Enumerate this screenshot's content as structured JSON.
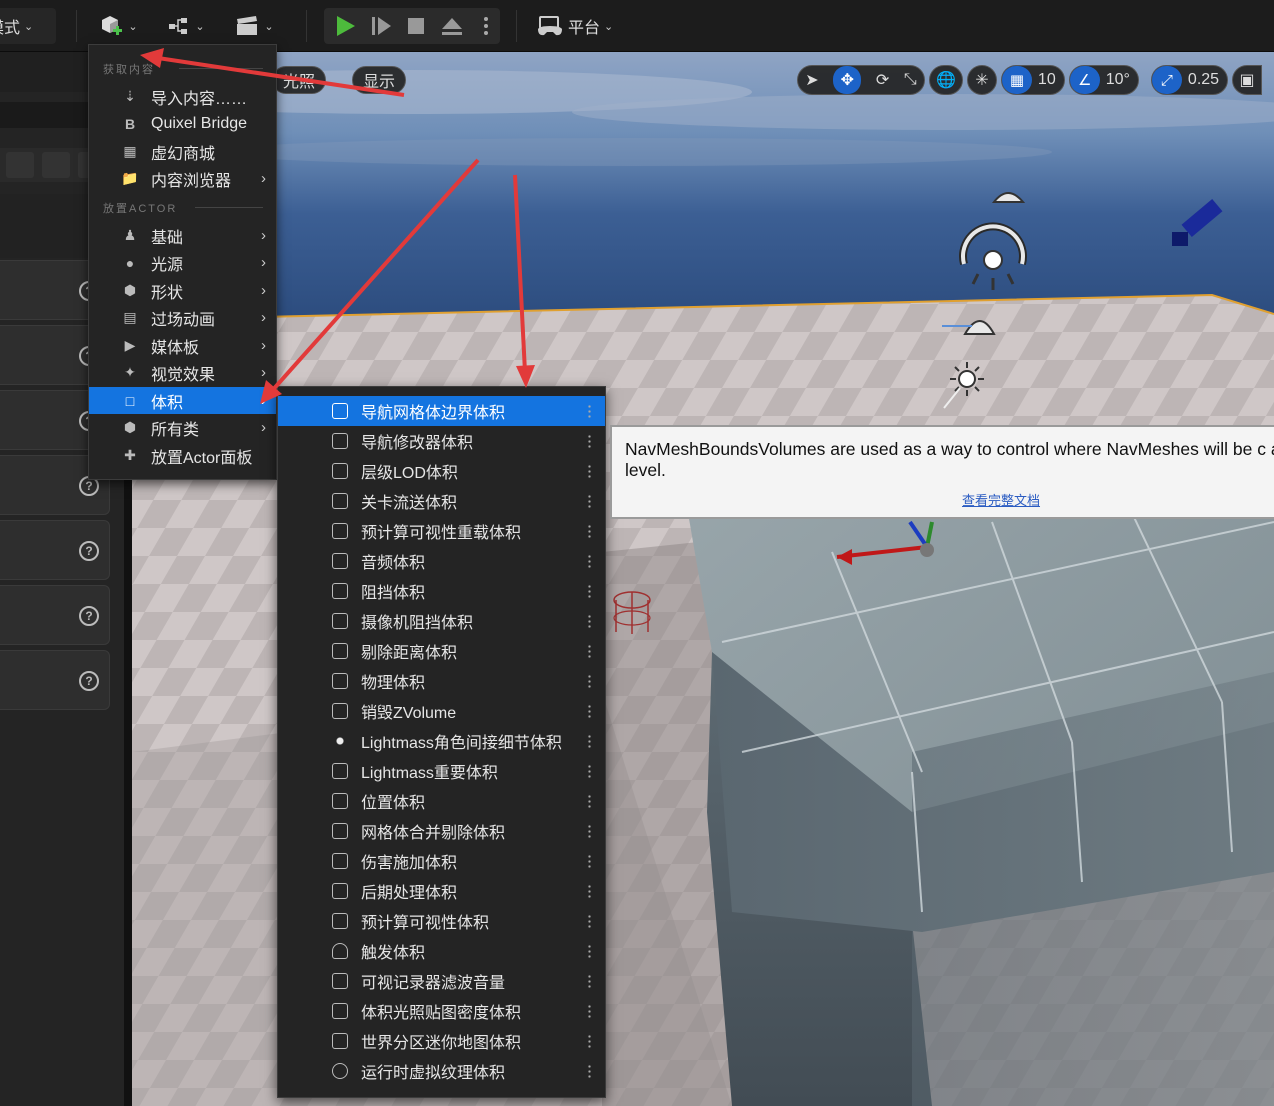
{
  "toolbar": {
    "mode_label": "模式",
    "platform_label": "平台"
  },
  "viewport": {
    "lighting_label": "光照",
    "show_label": "显示",
    "grid_snap_value": "10",
    "rotation_snap_value": "10°",
    "scale_snap_value": "0.25"
  },
  "create_menu": {
    "get_content_title": "获取内容",
    "place_actor_title": "放置ACTOR",
    "get_content_items": [
      {
        "label": "导入内容……",
        "icon": "import-icon",
        "has_submenu": false
      },
      {
        "label": "Quixel Bridge",
        "icon": "bridge-icon",
        "has_submenu": false
      },
      {
        "label": "虚幻商城",
        "icon": "marketplace-icon",
        "has_submenu": false
      },
      {
        "label": "内容浏览器",
        "icon": "content-browser-icon",
        "has_submenu": true
      }
    ],
    "place_actor_items": [
      {
        "label": "基础",
        "icon": "basic-icon",
        "has_submenu": true
      },
      {
        "label": "光源",
        "icon": "light-icon",
        "has_submenu": true
      },
      {
        "label": "形状",
        "icon": "shape-icon",
        "has_submenu": true
      },
      {
        "label": "过场动画",
        "icon": "cinematic-icon",
        "has_submenu": true
      },
      {
        "label": "媒体板",
        "icon": "media-icon",
        "has_submenu": true
      },
      {
        "label": "视觉效果",
        "icon": "vfx-icon",
        "has_submenu": true
      },
      {
        "label": "体积",
        "icon": "volume-icon",
        "has_submenu": true,
        "highlighted": true
      },
      {
        "label": "所有类",
        "icon": "all-classes-icon",
        "has_submenu": true
      },
      {
        "label": "放置Actor面板",
        "icon": "place-actors-panel-icon",
        "has_submenu": false
      }
    ]
  },
  "volume_menu": {
    "items": [
      {
        "label": "导航网格体边界体积",
        "highlighted": true
      },
      {
        "label": "导航修改器体积"
      },
      {
        "label": "层级LOD体积"
      },
      {
        "label": "关卡流送体积"
      },
      {
        "label": "预计算可视性重载体积"
      },
      {
        "label": "音频体积"
      },
      {
        "label": "阻挡体积"
      },
      {
        "label": "摄像机阻挡体积"
      },
      {
        "label": "剔除距离体积"
      },
      {
        "label": "物理体积"
      },
      {
        "label": "销毁ZVolume"
      },
      {
        "label": "Lightmass角色间接细节体积"
      },
      {
        "label": "Lightmass重要体积"
      },
      {
        "label": "位置体积"
      },
      {
        "label": "网格体合并剔除体积"
      },
      {
        "label": "伤害施加体积"
      },
      {
        "label": "后期处理体积"
      },
      {
        "label": "预计算可视性体积"
      },
      {
        "label": "触发体积"
      },
      {
        "label": "可视记录器滤波音量"
      },
      {
        "label": "体积光照贴图密度体积"
      },
      {
        "label": "世界分区迷你地图体积"
      },
      {
        "label": "运行时虚拟纹理体积"
      }
    ]
  },
  "tooltip": {
    "text": "NavMeshBoundsVolumes are used as a way to control where NavMeshes will be c a level.",
    "link_label": "查看完整文档"
  },
  "colors": {
    "highlight": "#1474e0",
    "annotation_arrow": "#e23a3a",
    "toolbar_bg": "#1c1c1c",
    "menu_bg": "#242424"
  }
}
